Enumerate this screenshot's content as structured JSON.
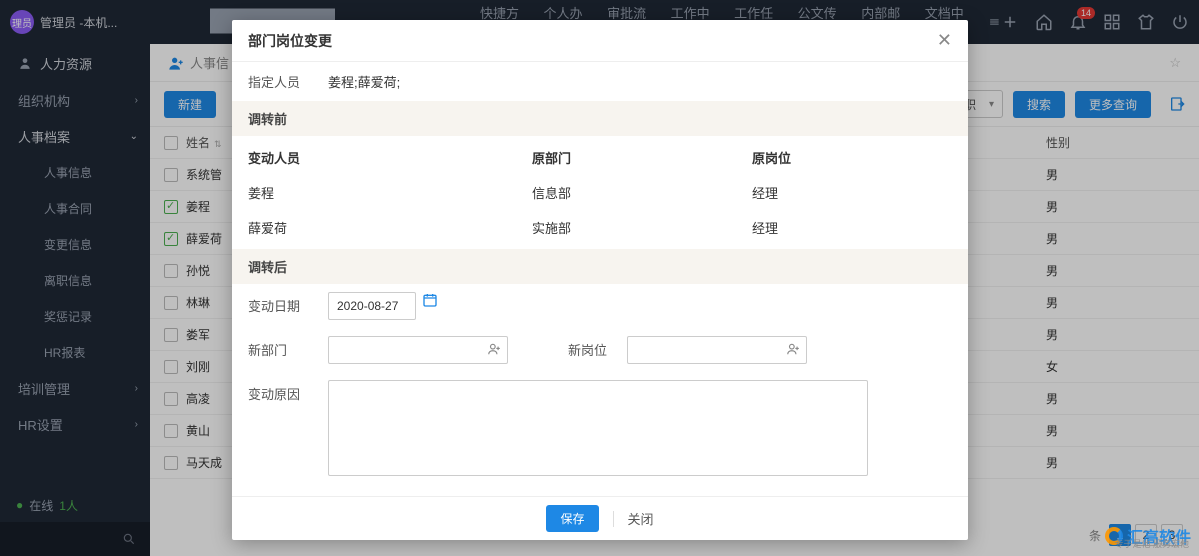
{
  "topbar": {
    "brand_badge": "理员",
    "brand_text": "管理员 -本机...",
    "nav": [
      "快捷方式",
      "个人办公",
      "审批流转",
      "工作中心",
      "工作任务",
      "公文传递",
      "内部邮件",
      "文档中心"
    ],
    "notif_count": "14"
  },
  "sidebar": {
    "header": "人力资源",
    "items": [
      {
        "label": "组织机构",
        "caret": ">"
      },
      {
        "label": "人事档案",
        "caret": "v",
        "open": true
      },
      {
        "label": "培训管理",
        "caret": ">"
      },
      {
        "label": "HR设置",
        "caret": ">"
      }
    ],
    "subs": [
      "人事信息",
      "人事合同",
      "变更信息",
      "离职信息",
      "奖惩记录",
      "HR报表"
    ],
    "online_label": "在线",
    "online_count": "1人"
  },
  "main": {
    "breadcrumb": "人事信",
    "new_btn": "新建",
    "status_filter": "在职",
    "search_btn": "搜索",
    "more_btn": "更多查询",
    "cols": {
      "name": "姓名",
      "gender": "性别"
    },
    "rows": [
      {
        "name": "系统管",
        "gender": "男",
        "checked": false
      },
      {
        "name": "姜程",
        "gender": "男",
        "checked": true
      },
      {
        "name": "薛爱荷",
        "gender": "男",
        "checked": true
      },
      {
        "name": "孙悦",
        "gender": "男",
        "checked": false
      },
      {
        "name": "林琳",
        "gender": "男",
        "checked": false
      },
      {
        "name": "娄军",
        "gender": "男",
        "checked": false
      },
      {
        "name": "刘刚",
        "gender": "女",
        "checked": false
      },
      {
        "name": "高凌",
        "gender": "男",
        "checked": false
      },
      {
        "name": "黄山",
        "gender": "男",
        "checked": false
      },
      {
        "name": "马天成",
        "gender": "男",
        "checked": false
      }
    ],
    "pager_label": "条",
    "pages": [
      "1",
      "2",
      "3"
    ]
  },
  "modal": {
    "title": "部门岗位变更",
    "assigned_label": "指定人员",
    "assigned_value": "姜程;薛爱荷;",
    "before_header": "调转前",
    "before_cols": {
      "person": "变动人员",
      "dept": "原部门",
      "post": "原岗位"
    },
    "before_rows": [
      {
        "person": "姜程",
        "dept": "信息部",
        "post": "经理"
      },
      {
        "person": "薛爱荷",
        "dept": "实施部",
        "post": "经理"
      }
    ],
    "after_header": "调转后",
    "date_label": "变动日期",
    "date_value": "2020-08-27",
    "newdept_label": "新部门",
    "newpost_label": "新岗位",
    "reason_label": "变动原因",
    "save_btn": "保存",
    "close_btn": "关闭"
  },
  "watermark": {
    "brand": "汇高软件",
    "sub": "专于是他 服务宏他"
  }
}
